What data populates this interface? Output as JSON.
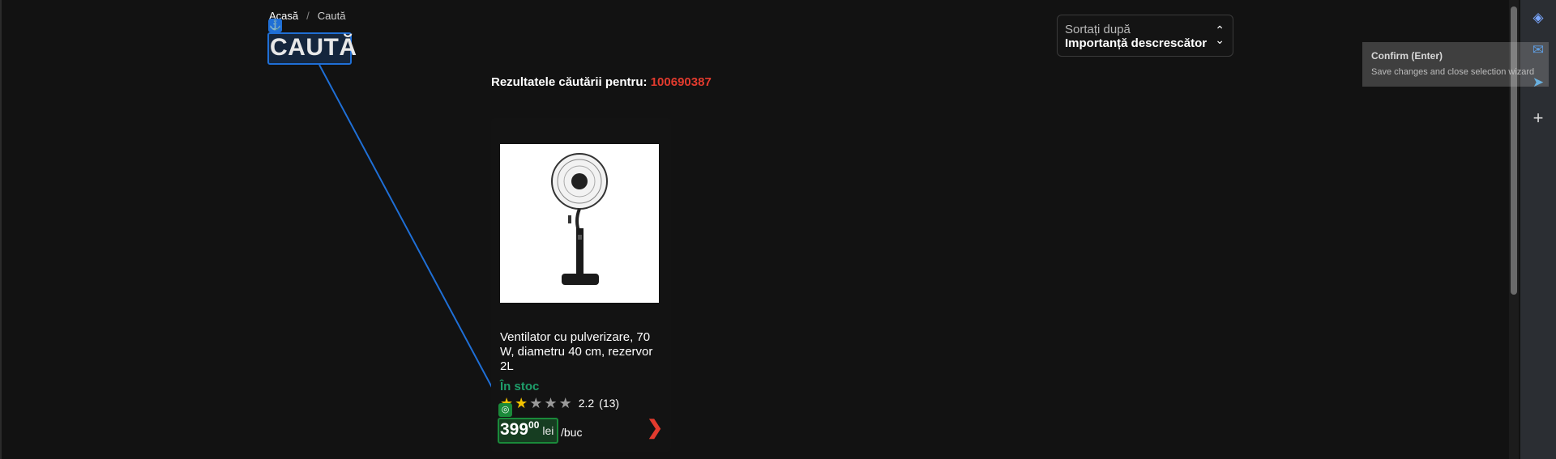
{
  "breadcrumb": {
    "home": "Acasă",
    "separator": "/",
    "current": "Caută"
  },
  "page_title": "CAUTĂ",
  "sort": {
    "label": "Sortați după",
    "value": "Importanță descrescător"
  },
  "results": {
    "prefix": "Rezultatele căutării pentru:",
    "query": "100690387"
  },
  "product": {
    "name": "Ventilator cu pulverizare, 70 W, diametru 40 cm, rezervor 2L",
    "stock": "În stoc",
    "rating": {
      "value": 2.2,
      "text": "2.2",
      "count": "(13)",
      "stars_filled": 2,
      "stars_total": 5
    },
    "price": {
      "integer": "399",
      "decimals": "00",
      "currency": "lei",
      "unit": "/buc"
    }
  },
  "tooltip": {
    "title": "Confirm (Enter)",
    "text": "Save changes and close selection wizard"
  },
  "side_icons": [
    "copilot-icon",
    "outlook-icon",
    "send-icon",
    "add-icon"
  ],
  "colors": {
    "accent_red": "#e23b2e",
    "stock_green": "#1e9e6a",
    "selection_blue": "#1f6fd6",
    "star": "#f2c200"
  }
}
